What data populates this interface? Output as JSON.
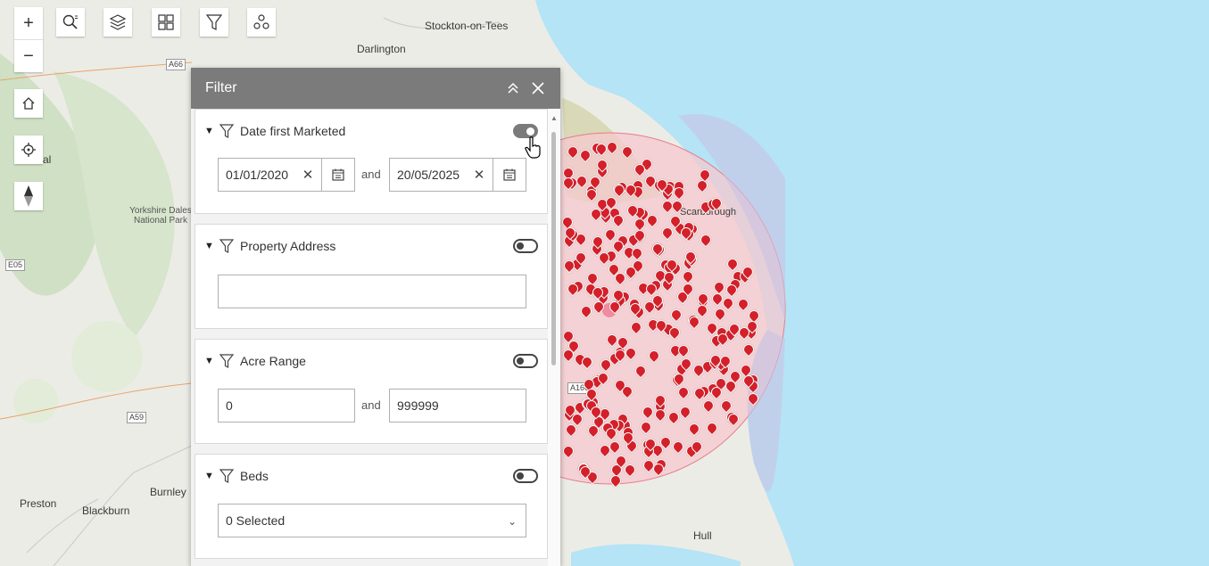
{
  "map": {
    "places": [
      {
        "name": "Stockton-on-Tees"
      },
      {
        "name": "Darlington"
      },
      {
        "name": "Scarborough"
      },
      {
        "name": "Yorkshire Dales National Park"
      },
      {
        "name": "Preston"
      },
      {
        "name": "Blackburn"
      },
      {
        "name": "Burnley"
      },
      {
        "name": "Hull"
      },
      {
        "name": "al"
      }
    ],
    "roads": [
      "A66",
      "A59",
      "A166",
      "E05"
    ],
    "colors": {
      "sea": "#b4e4f6",
      "land": "#ecece6",
      "buffer": "#f5c8cd",
      "pin": "#d4202a"
    }
  },
  "toolbar": {
    "zoom_in": "+",
    "zoom_out": "−",
    "icons": [
      "search-icon",
      "layers-icon",
      "basemap-gallery-icon",
      "filter-icon",
      "select-icon",
      "home-icon",
      "locate-icon",
      "compass-icon"
    ]
  },
  "filter_panel": {
    "title": "Filter",
    "sections": [
      {
        "title": "Date first Marketed",
        "enabled": true,
        "from": "01/01/2020",
        "to": "20/05/2025",
        "joiner": "and"
      },
      {
        "title": "Property Address",
        "enabled": false,
        "value": ""
      },
      {
        "title": "Acre Range",
        "enabled": false,
        "from": "0",
        "to": "999999",
        "joiner": "and"
      },
      {
        "title": "Beds",
        "enabled": false,
        "selected": "0 Selected"
      }
    ]
  }
}
